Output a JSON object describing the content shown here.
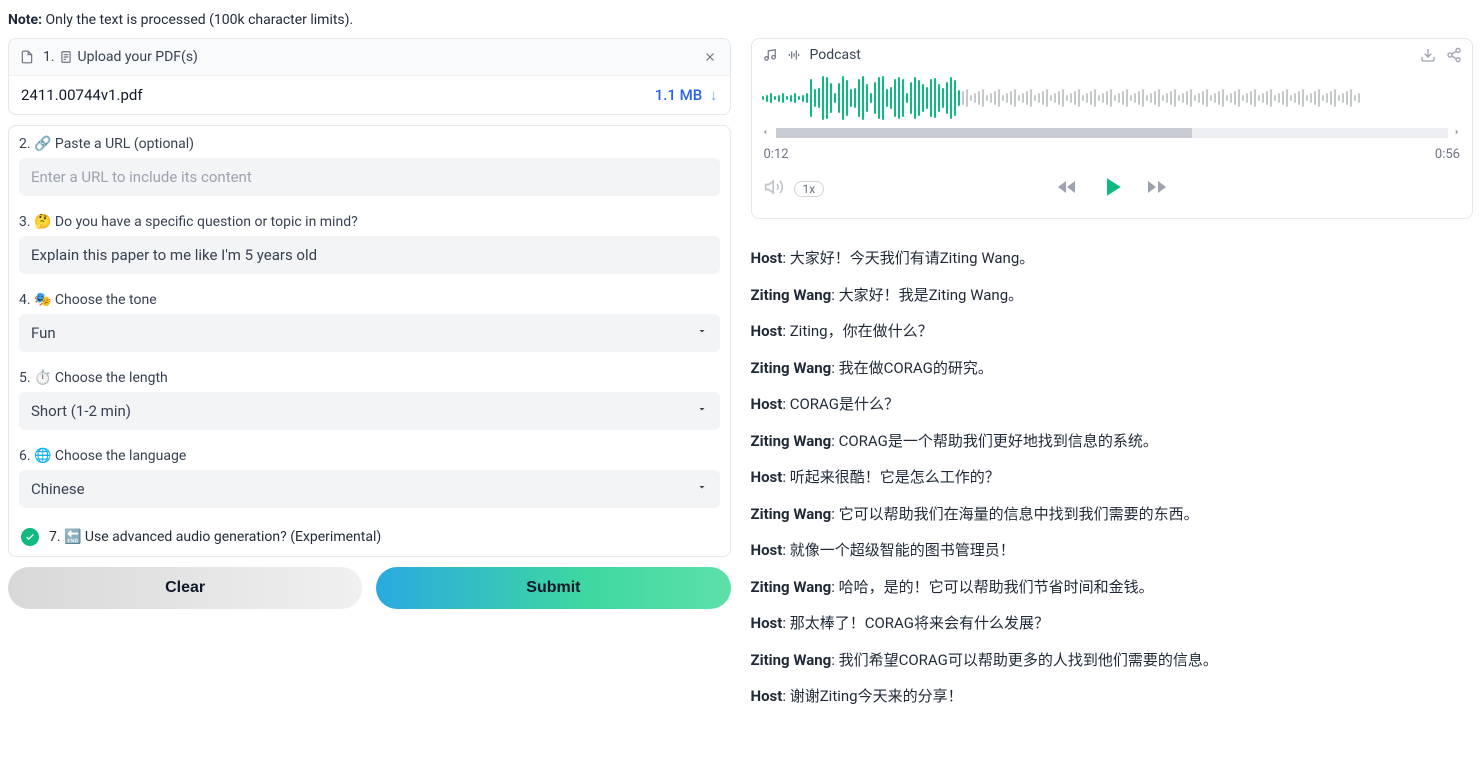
{
  "note_prefix": "Note:",
  "note_text": " Only the text is processed (100k character limits).",
  "upload": {
    "step": "1. ",
    "label": "Upload your PDF(s)",
    "file_name": "2411.00744v1.pdf",
    "file_size": "1.1 MB",
    "download_glyph": "↓"
  },
  "url_section": {
    "label": "2. 🔗 Paste a URL (optional)",
    "placeholder": "Enter a URL to include its content",
    "value": ""
  },
  "question_section": {
    "label": "3. 🤔 Do you have a specific question or topic in mind?",
    "value": "Explain this paper to me like I'm 5 years old"
  },
  "tone_section": {
    "label": "4. 🎭 Choose the tone",
    "value": "Fun"
  },
  "length_section": {
    "label": "5. ⏱️ Choose the length",
    "value": "Short (1-2 min)"
  },
  "language_section": {
    "label": "6. 🌐 Choose the language",
    "value": "Chinese"
  },
  "advanced_section": {
    "label": "7. 🔚 Use advanced audio generation? (Experimental)"
  },
  "buttons": {
    "clear": "Clear",
    "submit": "Submit"
  },
  "podcast": {
    "title": "Podcast",
    "current_time": "0:12",
    "total_time": "0:56",
    "speed": "1x",
    "progress_percent": 62
  },
  "transcript": [
    {
      "speaker": "Host",
      "text": ": 大家好！今天我们有请Ziting Wang。"
    },
    {
      "speaker": "Ziting Wang",
      "text": ": 大家好！我是Ziting Wang。"
    },
    {
      "speaker": "Host",
      "text": ": Ziting，你在做什么？"
    },
    {
      "speaker": "Ziting Wang",
      "text": ": 我在做CORAG的研究。"
    },
    {
      "speaker": "Host",
      "text": ": CORAG是什么？"
    },
    {
      "speaker": "Ziting Wang",
      "text": ": CORAG是一个帮助我们更好地找到信息的系统。"
    },
    {
      "speaker": "Host",
      "text": ": 听起来很酷！它是怎么工作的？"
    },
    {
      "speaker": "Ziting Wang",
      "text": ": 它可以帮助我们在海量的信息中找到我们需要的东西。"
    },
    {
      "speaker": "Host",
      "text": ": 就像一个超级智能的图书管理员！"
    },
    {
      "speaker": "Ziting Wang",
      "text": ": 哈哈，是的！它可以帮助我们节省时间和金钱。"
    },
    {
      "speaker": "Host",
      "text": ": 那太棒了！CORAG将来会有什么发展？"
    },
    {
      "speaker": "Ziting Wang",
      "text": ": 我们希望CORAG可以帮助更多的人找到他们需要的信息。"
    },
    {
      "speaker": "Host",
      "text": ": 谢谢Ziting今天来的分享！"
    }
  ]
}
